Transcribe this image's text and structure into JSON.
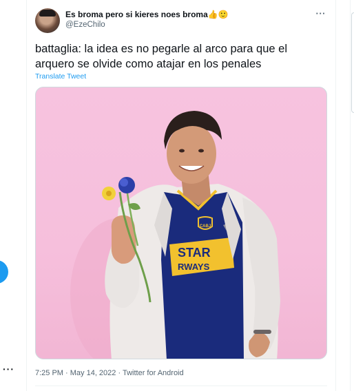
{
  "tweet": {
    "display_name": "Es broma pero si kieres noes broma",
    "display_name_emojis": "👍🙂",
    "handle": "@EzeChilo",
    "text": "battaglia: la idea es no pegarle al arco para que el arquero se olvide como atajar en los penales",
    "translate_label": "Translate Tweet",
    "meta": "7:25 PM · May 14, 2022 · Twitter for Android"
  },
  "media": {
    "jersey_sponsor_line1": "STAR",
    "jersey_sponsor_line2": "RWAYS",
    "jersey_badge": "CABJ"
  },
  "icons": {
    "more": "more-horizontal-icon",
    "compose": "compose-fab-icon"
  },
  "colors": {
    "accent": "#1d9bf0",
    "background_pink": "#f6bfdc",
    "jersey_blue": "#1a2b7c",
    "jersey_gold": "#f2c12e"
  }
}
